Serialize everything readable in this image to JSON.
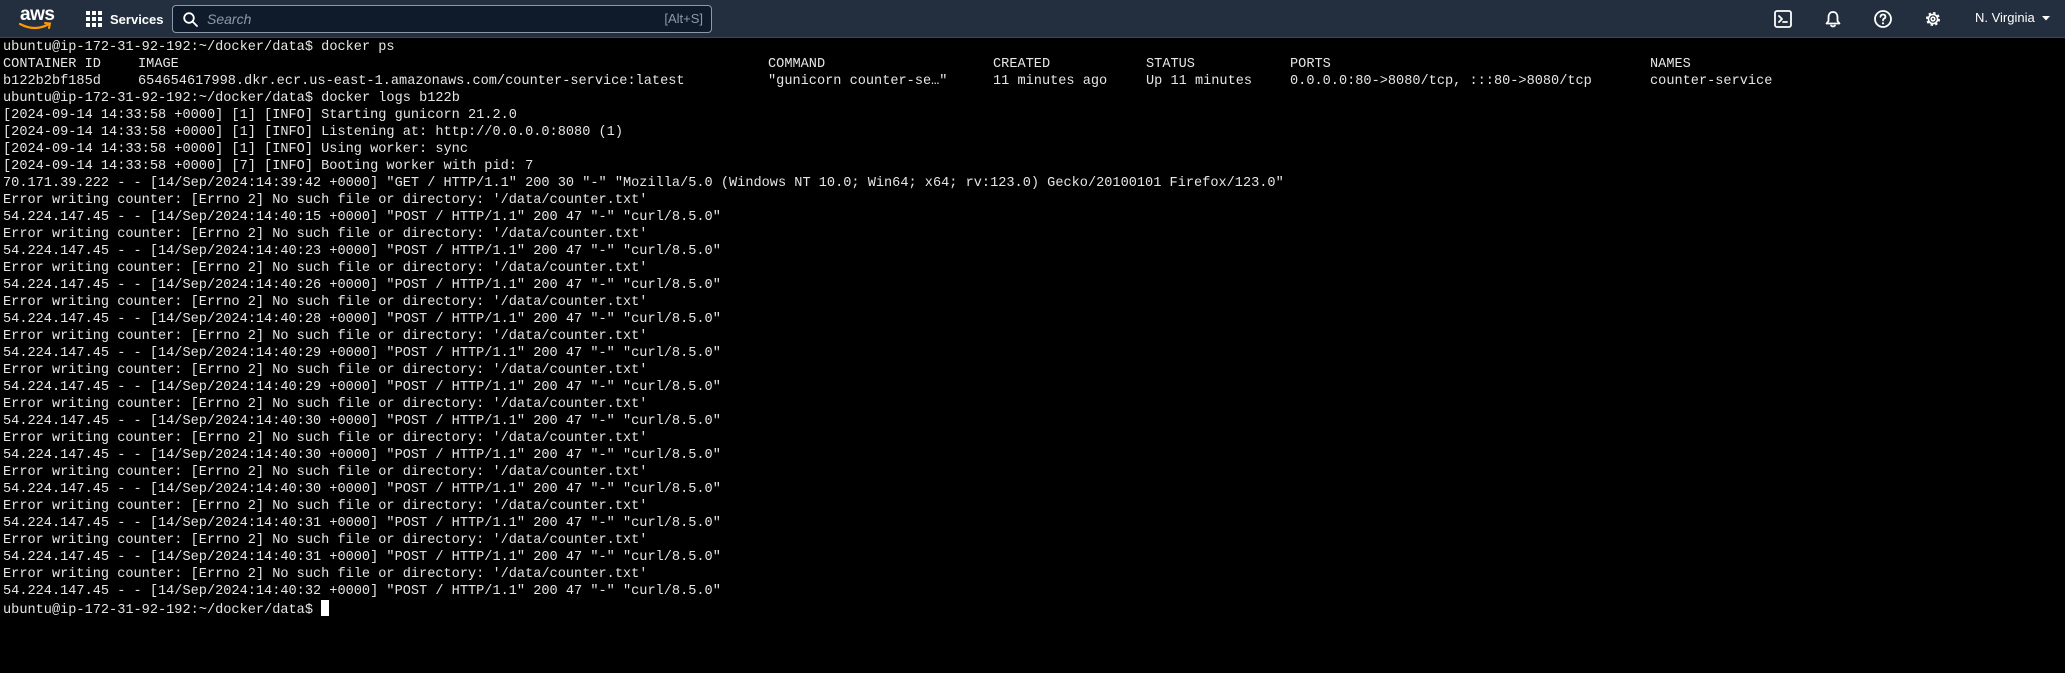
{
  "topbar": {
    "logo": "aws",
    "services_label": "Services",
    "search": {
      "placeholder": "Search",
      "shortcut": "[Alt+S]"
    },
    "icons": [
      "cloudshell-icon",
      "bell-icon",
      "help-icon",
      "settings-icon"
    ],
    "region_label": "N. Virginia",
    "colors": {
      "bar_bg": "#232f3e",
      "logo_smile": "#ff9900"
    }
  },
  "terminal": {
    "prompt": "ubuntu@ip-172-31-92-192:~/docker/data$",
    "cmd_ps": "docker ps",
    "ps_table": {
      "headers": [
        "CONTAINER ID",
        "IMAGE",
        "COMMAND",
        "CREATED",
        "STATUS",
        "PORTS",
        "NAMES"
      ],
      "rows": [
        [
          "b122b2bf185d",
          "654654617998.dkr.ecr.us-east-1.amazonaws.com/counter-service:latest",
          "\"gunicorn counter-se…\"",
          "11 minutes ago",
          "Up 11 minutes",
          "0.0.0.0:80->8080/tcp, :::80->8080/tcp",
          "counter-service"
        ]
      ]
    },
    "cmd_logs": "docker logs b122b",
    "log_lines": [
      "[2024-09-14 14:33:58 +0000] [1] [INFO] Starting gunicorn 21.2.0",
      "[2024-09-14 14:33:58 +0000] [1] [INFO] Listening at: http://0.0.0.0:8080 (1)",
      "[2024-09-14 14:33:58 +0000] [1] [INFO] Using worker: sync",
      "[2024-09-14 14:33:58 +0000] [7] [INFO] Booting worker with pid: 7",
      "70.171.39.222 - - [14/Sep/2024:14:39:42 +0000] \"GET / HTTP/1.1\" 200 30 \"-\" \"Mozilla/5.0 (Windows NT 10.0; Win64; x64; rv:123.0) Gecko/20100101 Firefox/123.0\"",
      "Error writing counter: [Errno 2] No such file or directory: '/data/counter.txt'",
      "54.224.147.45 - - [14/Sep/2024:14:40:15 +0000] \"POST / HTTP/1.1\" 200 47 \"-\" \"curl/8.5.0\"",
      "Error writing counter: [Errno 2] No such file or directory: '/data/counter.txt'",
      "54.224.147.45 - - [14/Sep/2024:14:40:23 +0000] \"POST / HTTP/1.1\" 200 47 \"-\" \"curl/8.5.0\"",
      "Error writing counter: [Errno 2] No such file or directory: '/data/counter.txt'",
      "54.224.147.45 - - [14/Sep/2024:14:40:26 +0000] \"POST / HTTP/1.1\" 200 47 \"-\" \"curl/8.5.0\"",
      "Error writing counter: [Errno 2] No such file or directory: '/data/counter.txt'",
      "54.224.147.45 - - [14/Sep/2024:14:40:28 +0000] \"POST / HTTP/1.1\" 200 47 \"-\" \"curl/8.5.0\"",
      "Error writing counter: [Errno 2] No such file or directory: '/data/counter.txt'",
      "54.224.147.45 - - [14/Sep/2024:14:40:29 +0000] \"POST / HTTP/1.1\" 200 47 \"-\" \"curl/8.5.0\"",
      "Error writing counter: [Errno 2] No such file or directory: '/data/counter.txt'",
      "54.224.147.45 - - [14/Sep/2024:14:40:29 +0000] \"POST / HTTP/1.1\" 200 47 \"-\" \"curl/8.5.0\"",
      "Error writing counter: [Errno 2] No such file or directory: '/data/counter.txt'",
      "54.224.147.45 - - [14/Sep/2024:14:40:30 +0000] \"POST / HTTP/1.1\" 200 47 \"-\" \"curl/8.5.0\"",
      "Error writing counter: [Errno 2] No such file or directory: '/data/counter.txt'",
      "54.224.147.45 - - [14/Sep/2024:14:40:30 +0000] \"POST / HTTP/1.1\" 200 47 \"-\" \"curl/8.5.0\"",
      "Error writing counter: [Errno 2] No such file or directory: '/data/counter.txt'",
      "54.224.147.45 - - [14/Sep/2024:14:40:30 +0000] \"POST / HTTP/1.1\" 200 47 \"-\" \"curl/8.5.0\"",
      "Error writing counter: [Errno 2] No such file or directory: '/data/counter.txt'",
      "54.224.147.45 - - [14/Sep/2024:14:40:31 +0000] \"POST / HTTP/1.1\" 200 47 \"-\" \"curl/8.5.0\"",
      "Error writing counter: [Errno 2] No such file or directory: '/data/counter.txt'",
      "54.224.147.45 - - [14/Sep/2024:14:40:31 +0000] \"POST / HTTP/1.1\" 200 47 \"-\" \"curl/8.5.0\"",
      "Error writing counter: [Errno 2] No such file or directory: '/data/counter.txt'",
      "54.224.147.45 - - [14/Sep/2024:14:40:32 +0000] \"POST / HTTP/1.1\" 200 47 \"-\" \"curl/8.5.0\""
    ],
    "colors": {
      "bg": "#000000",
      "fg": "#e6e6e6"
    }
  }
}
